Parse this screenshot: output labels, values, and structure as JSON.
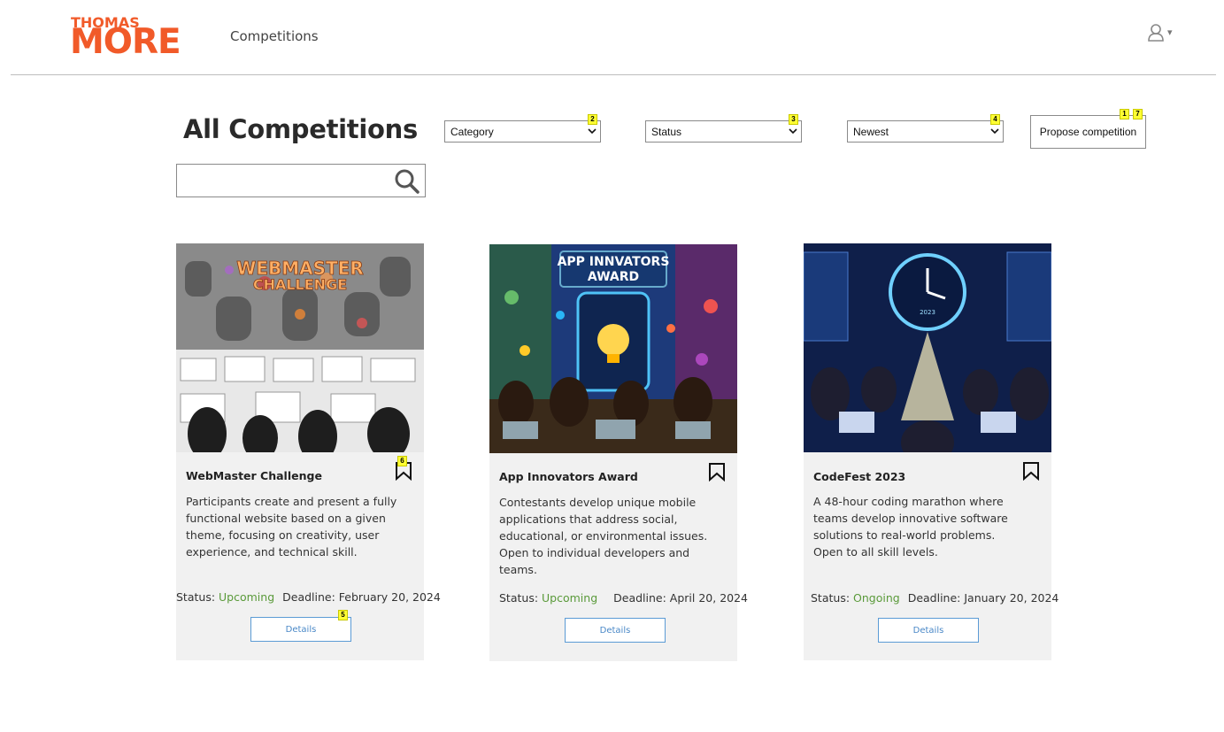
{
  "header": {
    "logo_line1": "THOMAS",
    "logo_line2": "MORE",
    "nav_competitions": "Competitions",
    "user_caret": "▾"
  },
  "toolbar": {
    "title": "All Competitions",
    "category": {
      "selected": "Category",
      "badge": "2"
    },
    "status": {
      "selected": "Status",
      "badge": "3"
    },
    "sort": {
      "selected": "Newest",
      "badge": "4"
    },
    "propose": {
      "label": "Propose competition",
      "badge_a": "1",
      "badge_b": "7"
    },
    "search": {
      "value": "",
      "placeholder": ""
    }
  },
  "colors": {
    "brand": "#f15a29",
    "status_value": "#5a9a3a",
    "details_border": "#5b9bd5",
    "card_bg": "#f1f1f1",
    "badge": "#ffff33"
  },
  "cards": [
    {
      "title": "WebMaster Challenge",
      "image_text_1": "WEBMASTER",
      "image_text_2": "CHALLENGE",
      "description": "Participants create and present a fully functional website based on a given theme, focusing on creativity, user experience, and technical skill.",
      "status_label": "Status:",
      "status_value": "Upcoming",
      "deadline": "Deadline: February 20, 2024",
      "details_label": "Details",
      "bookmark_badge": "6",
      "details_badge": "5"
    },
    {
      "title": "App Innovators Award",
      "image_text_1": "APP INNVATORS",
      "image_text_2": "AWARD",
      "description": "Contestants develop unique mobile applications that address social, educational, or environmental issues. Open to individual developers and teams.",
      "status_label": "Status:",
      "status_value": "Upcoming",
      "deadline": "Deadline: April 20, 2024",
      "details_label": "Details"
    },
    {
      "title": "CodeFest 2023",
      "image_text_1": "2023",
      "description": "A 48-hour coding marathon where teams develop innovative software solutions to real-world problems. Open to all skill levels.",
      "status_label": "Status:",
      "status_value": "Ongoing",
      "deadline": "Deadline: January 20, 2024",
      "details_label": "Details"
    }
  ]
}
